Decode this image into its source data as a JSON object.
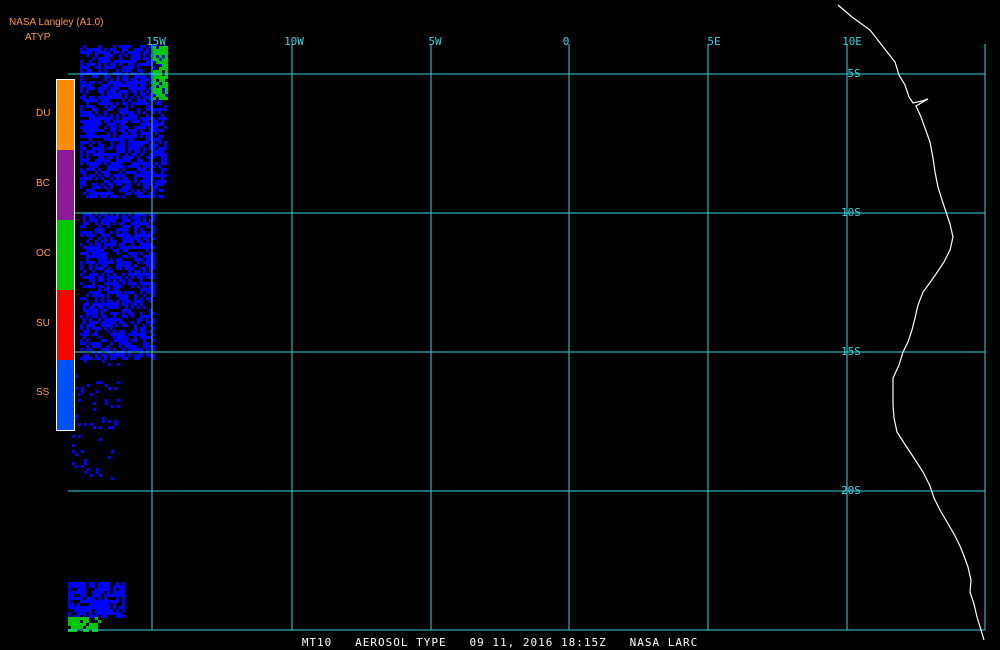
{
  "header": {
    "line1": "NASA Langley (A1.0)",
    "line2": "ATYP"
  },
  "footer": {
    "caption": "MT10   AEROSOL TYPE   09 11, 2016 18:15Z   NASA LARC"
  },
  "colors": {
    "background": "#000000",
    "grid": "#33d6e0",
    "coast": "#ffffff",
    "legend_border": "#ffffff"
  },
  "legend": [
    {
      "label": "DU",
      "color": "#ff8c00"
    },
    {
      "label": "BC",
      "color": "#8c1a99"
    },
    {
      "label": "OC",
      "color": "#00c800"
    },
    {
      "label": "SU",
      "color": "#ff0000"
    },
    {
      "label": "SS",
      "color": "#0050ff"
    }
  ],
  "longitude_labels": [
    "15W",
    "10W",
    "5W",
    "0",
    "5E",
    "10E"
  ],
  "latitude_labels": [
    "5S",
    "10S",
    "15S",
    "20S"
  ],
  "aerosol_colors": {
    "dominant": "#0000ff",
    "minor": "#00c800"
  }
}
